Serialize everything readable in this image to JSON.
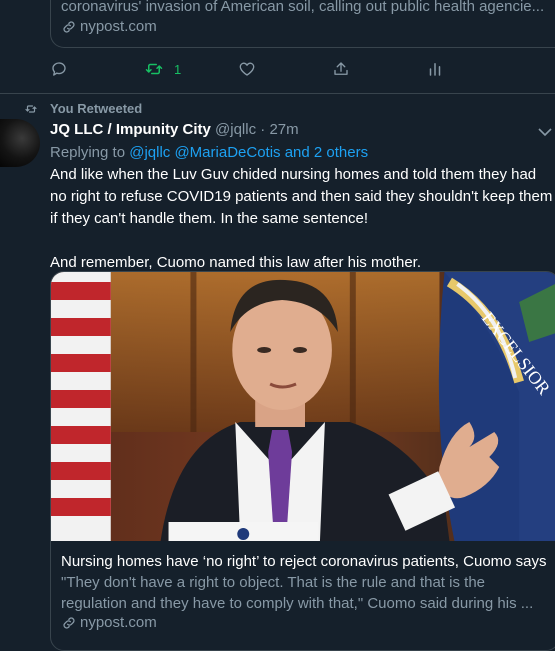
{
  "previous_tweet": {
    "card_description": "coronavirus' invasion of American soil, calling out public health agencie...",
    "card_domain": "nypost.com",
    "actions": {
      "reply_icon": "reply-icon",
      "retweet_icon": "retweet-icon",
      "retweet_count": "1",
      "like_icon": "heart-icon",
      "share_icon": "share-icon",
      "analytics_icon": "analytics-icon"
    },
    "retweet_color": "#17bf63"
  },
  "tweet": {
    "retweet_label": "You Retweeted",
    "display_name": "JQ LLC / Impunity City",
    "handle": "@jqllc",
    "separator": "·",
    "time": "27m",
    "replying_prefix": "Replying to",
    "replying_mentions": "@jqllc @MariaDeCotis and 2 others",
    "body_paragraph_1": "And like when the Luv Guv chided nursing homes and told them they had no right to refuse COVID19 patients and then said they shouldn't keep them if they can't handle them. In the same sentence!",
    "body_paragraph_2": "And remember, Cuomo named this law after his mother.",
    "card": {
      "title": "Nursing homes have ‘no right’ to reject coronavirus patients, Cuomo says",
      "summary": "\"They don't have a right to object. That is the rule and that is the regulation and they have to comply with that,\" Cuomo said during his ...",
      "domain": "nypost.com",
      "flag_text": "EXCELSIOR"
    }
  },
  "colors": {
    "background": "#15202b",
    "border": "#38444d",
    "muted_text": "#8899a6",
    "link": "#1da1f2"
  }
}
